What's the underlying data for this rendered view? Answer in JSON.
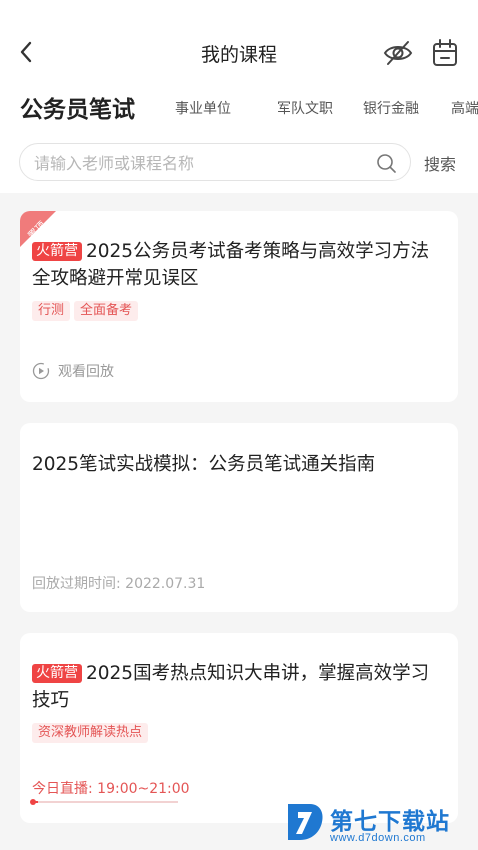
{
  "header": {
    "title": "我的课程"
  },
  "tabs": [
    {
      "label": "公务员笔试",
      "active": true
    },
    {
      "label": "事业单位"
    },
    {
      "label": "军队文职"
    },
    {
      "label": "银行金融"
    },
    {
      "label": "高端"
    }
  ],
  "search": {
    "placeholder": "请输入老师或课程名称",
    "value": "",
    "button_label": "搜索"
  },
  "courses": [
    {
      "corner_label": "置顶",
      "badge": "火箭营",
      "title": "2025公务员考试备考策略与高效学习方法全攻略避开常见误区",
      "tags": [
        "行测",
        "全面备考"
      ],
      "status": "观看回放"
    },
    {
      "title": "2025笔试实战模拟：公务员笔试通关指南",
      "status": "回放过期时间: 2022.07.31"
    },
    {
      "badge": "火箭营",
      "title": "2025国考热点知识大串讲，掌握高效学习技巧",
      "tags": [
        "资深教师解读热点"
      ],
      "status": "今日直播: 19:00~21:00",
      "progress": 0.04
    }
  ],
  "watermark": {
    "name": "第七下载站",
    "url": "www.d7down.com"
  },
  "colors": {
    "accent": "#ef4444",
    "tag_bg": "#fdecec",
    "watermark": "#1f78d1"
  }
}
